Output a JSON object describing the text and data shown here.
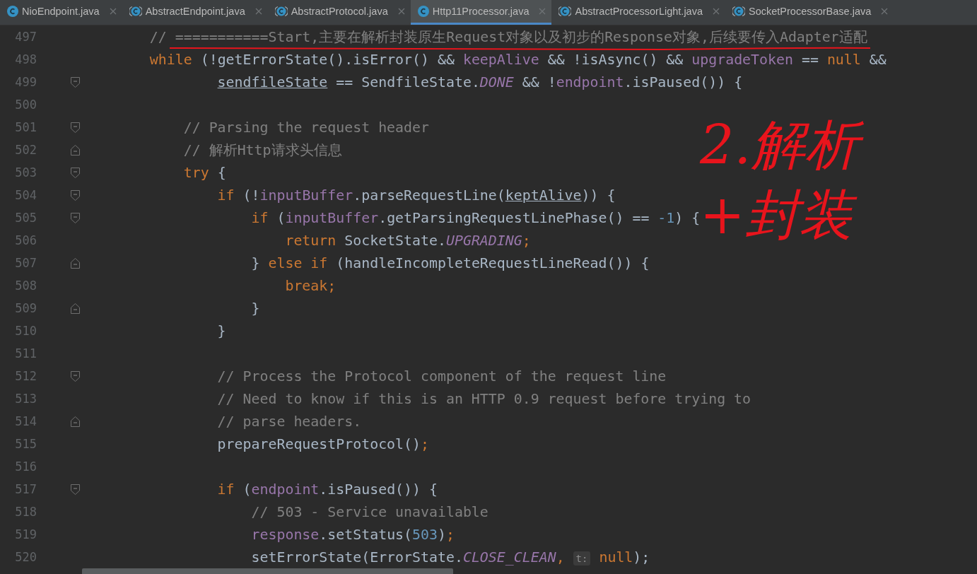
{
  "tabs": [
    {
      "label": "NioEndpoint.java",
      "kind": "class",
      "selected": false
    },
    {
      "label": "AbstractEndpoint.java",
      "kind": "abstract",
      "selected": false
    },
    {
      "label": "AbstractProtocol.java",
      "kind": "abstract",
      "selected": false
    },
    {
      "label": "Http11Processor.java",
      "kind": "class",
      "selected": true
    },
    {
      "label": "AbstractProcessorLight.java",
      "kind": "abstract",
      "selected": false
    },
    {
      "label": "SocketProcessorBase.java",
      "kind": "abstract",
      "selected": false
    }
  ],
  "editor": {
    "lines": [
      {
        "number": "497",
        "fold_start": false,
        "fold_end": false,
        "tokens": [
          {
            "kind": "comment",
            "text": "        // ===========Start,主要在解析封装原生Request对象以及初步的Response对象,后续要传入Adapter适配"
          }
        ]
      },
      {
        "number": "498",
        "fold_start": false,
        "fold_end": false,
        "tokens": [
          {
            "kind": "keyword",
            "text": "        while"
          },
          {
            "kind": "plain",
            "text": " (!getErrorState().isError() && "
          },
          {
            "kind": "field",
            "text": "keepAlive"
          },
          {
            "kind": "plain",
            "text": " && !isAsync() && "
          },
          {
            "kind": "field",
            "text": "upgradeToken"
          },
          {
            "kind": "plain",
            "text": " == "
          },
          {
            "kind": "keyword",
            "text": "null"
          },
          {
            "kind": "plain",
            "text": " &&"
          }
        ]
      },
      {
        "number": "499",
        "fold_start": true,
        "fold_end": false,
        "tokens": [
          {
            "kind": "underlined",
            "text": "                sendfileState"
          },
          {
            "kind": "plain",
            "text": " == SendfileState."
          },
          {
            "kind": "static",
            "text": "DONE"
          },
          {
            "kind": "plain",
            "text": " && !"
          },
          {
            "kind": "field",
            "text": "endpoint"
          },
          {
            "kind": "plain",
            "text": ".isPaused()) {"
          }
        ]
      },
      {
        "number": "500",
        "fold_start": false,
        "fold_end": false
      },
      {
        "number": "501",
        "fold_start": true,
        "fold_end": false,
        "tokens": [
          {
            "kind": "comment",
            "text": "            // Parsing the request header"
          }
        ]
      },
      {
        "number": "502",
        "fold_start": false,
        "fold_end": true,
        "tokens": [
          {
            "kind": "comment",
            "text": "            // 解析Http请求头信息"
          }
        ]
      },
      {
        "number": "503",
        "fold_start": true,
        "fold_end": false,
        "tokens": [
          {
            "kind": "keyword",
            "text": "            try"
          },
          {
            "kind": "plain",
            "text": " {"
          }
        ]
      },
      {
        "number": "504",
        "fold_start": true,
        "fold_end": false,
        "tokens": [
          {
            "kind": "keyword",
            "text": "                if"
          },
          {
            "kind": "plain",
            "text": " (!"
          },
          {
            "kind": "field",
            "text": "inputBuffer"
          },
          {
            "kind": "plain",
            "text": ".parseRequestLine("
          },
          {
            "kind": "underlined",
            "text": "keptAlive"
          },
          {
            "kind": "plain",
            "text": ")) {"
          }
        ]
      },
      {
        "number": "505",
        "fold_start": true,
        "fold_end": false,
        "tokens": [
          {
            "kind": "keyword",
            "text": "                    if"
          },
          {
            "kind": "plain",
            "text": " ("
          },
          {
            "kind": "field",
            "text": "inputBuffer"
          },
          {
            "kind": "plain",
            "text": ".getParsingRequestLinePhase() == "
          },
          {
            "kind": "number",
            "text": "-1"
          },
          {
            "kind": "plain",
            "text": ") {"
          }
        ]
      },
      {
        "number": "506",
        "fold_start": false,
        "fold_end": false,
        "tokens": [
          {
            "kind": "keyword",
            "text": "                        return"
          },
          {
            "kind": "plain",
            "text": " SocketState."
          },
          {
            "kind": "static",
            "text": "UPGRADING"
          },
          {
            "kind": "punct",
            "text": ";"
          }
        ]
      },
      {
        "number": "507",
        "fold_start": false,
        "fold_end": true,
        "tokens": [
          {
            "kind": "plain",
            "text": "                    } "
          },
          {
            "kind": "keyword",
            "text": "else if"
          },
          {
            "kind": "plain",
            "text": " (handleIncompleteRequestLineRead()) {"
          }
        ]
      },
      {
        "number": "508",
        "fold_start": false,
        "fold_end": false,
        "tokens": [
          {
            "kind": "keyword",
            "text": "                        break;"
          }
        ]
      },
      {
        "number": "509",
        "fold_start": false,
        "fold_end": true,
        "tokens": [
          {
            "kind": "plain",
            "text": "                    }"
          }
        ]
      },
      {
        "number": "510",
        "fold_start": false,
        "fold_end": false,
        "tokens": [
          {
            "kind": "plain",
            "text": "                }"
          }
        ]
      },
      {
        "number": "511",
        "fold_start": false,
        "fold_end": false
      },
      {
        "number": "512",
        "fold_start": true,
        "fold_end": false,
        "tokens": [
          {
            "kind": "comment",
            "text": "                // Process the Protocol component of the request line"
          }
        ]
      },
      {
        "number": "513",
        "fold_start": false,
        "fold_end": false,
        "tokens": [
          {
            "kind": "comment",
            "text": "                // Need to know if this is an HTTP 0.9 request before trying to"
          }
        ]
      },
      {
        "number": "514",
        "fold_start": false,
        "fold_end": true,
        "tokens": [
          {
            "kind": "comment",
            "text": "                // parse headers."
          }
        ]
      },
      {
        "number": "515",
        "fold_start": false,
        "fold_end": false,
        "tokens": [
          {
            "kind": "plain",
            "text": "                prepareRequestProtocol()"
          },
          {
            "kind": "punct",
            "text": ";"
          }
        ]
      },
      {
        "number": "516",
        "fold_start": false,
        "fold_end": false
      },
      {
        "number": "517",
        "fold_start": true,
        "fold_end": false,
        "tokens": [
          {
            "kind": "keyword",
            "text": "                if"
          },
          {
            "kind": "plain",
            "text": " ("
          },
          {
            "kind": "field",
            "text": "endpoint"
          },
          {
            "kind": "plain",
            "text": ".isPaused()) {"
          }
        ]
      },
      {
        "number": "518",
        "fold_start": false,
        "fold_end": false,
        "tokens": [
          {
            "kind": "comment",
            "text": "                    // 503 - Service unavailable"
          }
        ]
      },
      {
        "number": "519",
        "fold_start": false,
        "fold_end": false,
        "tokens": [
          {
            "kind": "field",
            "text": "                    response"
          },
          {
            "kind": "plain",
            "text": ".setStatus("
          },
          {
            "kind": "number",
            "text": "503"
          },
          {
            "kind": "plain",
            "text": ")"
          },
          {
            "kind": "punct",
            "text": ";"
          }
        ]
      },
      {
        "number": "520",
        "fold_start": false,
        "fold_end": false,
        "tokens": [
          {
            "kind": "plain",
            "text": "                    setErrorState(ErrorState."
          },
          {
            "kind": "static",
            "text": "CLOSE_CLEAN"
          },
          {
            "kind": "punct",
            "text": ", "
          },
          {
            "kind": "hint",
            "text": "t:"
          },
          {
            "kind": "keyword",
            "text": " null"
          },
          {
            "kind": "plain",
            "text": ");"
          }
        ]
      }
    ]
  },
  "annotation": {
    "text": "2.解析+封装"
  }
}
